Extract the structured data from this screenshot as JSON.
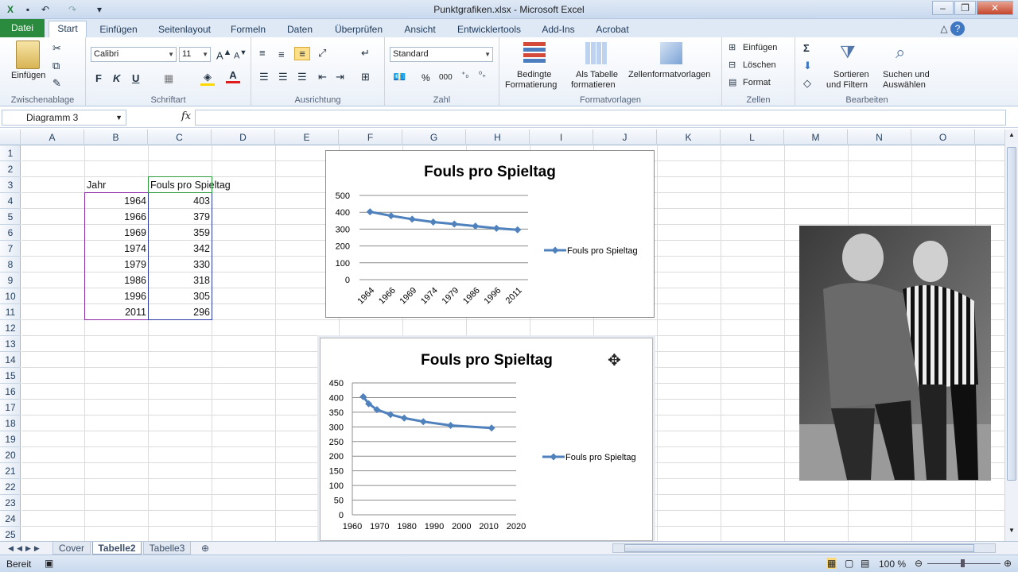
{
  "window": {
    "title": "Punktgrafiken.xlsx  -  Microsoft Excel"
  },
  "tabs": {
    "file": "Datei",
    "items": [
      "Start",
      "Einfügen",
      "Seitenlayout",
      "Formeln",
      "Daten",
      "Überprüfen",
      "Ansicht",
      "Entwicklertools",
      "Add-Ins",
      "Acrobat"
    ],
    "active": "Start"
  },
  "ribbon": {
    "clipboard": {
      "label": "Zwischenablage",
      "paste": "Einfügen"
    },
    "font": {
      "label": "Schriftart",
      "name": "Calibri",
      "size": "11",
      "bold": "F",
      "italic": "K",
      "underline": "U"
    },
    "alignment": {
      "label": "Ausrichtung"
    },
    "number": {
      "label": "Zahl",
      "format": "Standard",
      "percent": "%",
      "thousands": "000"
    },
    "styles": {
      "label": "Formatvorlagen",
      "conditional_1": "Bedingte",
      "conditional_2": "Formatierung",
      "as_table_1": "Als Tabelle",
      "as_table_2": "formatieren",
      "cell_styles": "Zellenformatvorlagen"
    },
    "cells": {
      "label": "Zellen",
      "insert": "Einfügen",
      "delete": "Löschen",
      "format": "Format"
    },
    "editing": {
      "label": "Bearbeiten",
      "sort_1": "Sortieren",
      "sort_2": "und Filtern",
      "find_1": "Suchen und",
      "find_2": "Auswählen"
    }
  },
  "formula_bar": {
    "name_box": "Diagramm 3",
    "fx": "fx",
    "value": ""
  },
  "columns": [
    "A",
    "B",
    "C",
    "D",
    "E",
    "F",
    "G",
    "H",
    "I",
    "J",
    "K",
    "L",
    "M",
    "N",
    "O"
  ],
  "rows": [
    "1",
    "2",
    "3",
    "4",
    "5",
    "6",
    "7",
    "8",
    "9",
    "10",
    "11",
    "12",
    "13",
    "14",
    "15",
    "16",
    "17",
    "18",
    "19",
    "20",
    "21",
    "22",
    "23",
    "24",
    "25"
  ],
  "table": {
    "header_year": "Jahr",
    "header_value": "Fouls pro Spieltag",
    "years": [
      "1964",
      "1966",
      "1969",
      "1974",
      "1979",
      "1986",
      "1996",
      "2011"
    ],
    "values": [
      "403",
      "379",
      "359",
      "342",
      "330",
      "318",
      "305",
      "296"
    ]
  },
  "chart_data": [
    {
      "type": "line",
      "title": "Fouls pro Spieltag",
      "categories": [
        "1964",
        "1966",
        "1969",
        "1974",
        "1979",
        "1986",
        "1996",
        "2011"
      ],
      "series": [
        {
          "name": "Fouls pro Spieltag",
          "values": [
            403,
            379,
            359,
            342,
            330,
            318,
            305,
            296
          ]
        }
      ],
      "yticks": [
        "0",
        "100",
        "200",
        "300",
        "400",
        "500"
      ],
      "ylim": [
        0,
        500
      ],
      "grid": true,
      "legend": "right",
      "color": "#4f81bd"
    },
    {
      "type": "scatter",
      "title": "Fouls pro Spieltag",
      "series": [
        {
          "name": "Fouls pro Spieltag",
          "x": [
            1964,
            1966,
            1969,
            1974,
            1979,
            1986,
            1996,
            2011
          ],
          "y": [
            403,
            379,
            359,
            342,
            330,
            318,
            305,
            296
          ]
        }
      ],
      "xticks": [
        "1960",
        "1970",
        "1980",
        "1990",
        "2000",
        "2010",
        "2020"
      ],
      "yticks": [
        "0",
        "50",
        "100",
        "150",
        "200",
        "250",
        "300",
        "350",
        "400",
        "450"
      ],
      "xlim": [
        1960,
        2020
      ],
      "ylim": [
        0,
        450
      ],
      "grid": true,
      "legend": "right",
      "color": "#4f81bd"
    }
  ],
  "sheets": {
    "items": [
      "Cover",
      "Tabelle2",
      "Tabelle3"
    ],
    "active": "Tabelle2"
  },
  "status": {
    "mode": "Bereit",
    "zoom": "100 %"
  }
}
